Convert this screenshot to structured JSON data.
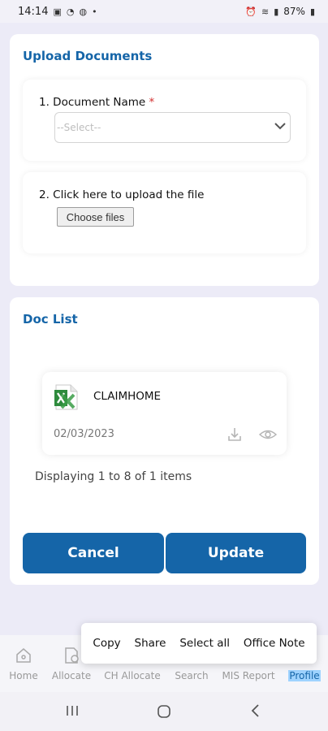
{
  "status_bar": {
    "time": "14:14",
    "battery": "87%"
  },
  "upload": {
    "title": "Upload Documents",
    "doc_name_label": "1.  Document Name",
    "required_mark": "*",
    "select_value": "--Select--",
    "upload_label": "2.  Click here to upload the file",
    "choose_files": "Choose files"
  },
  "doc_list": {
    "title": "Doc List",
    "items": [
      {
        "name": "CLAIMHOME",
        "date": "02/03/2023"
      }
    ],
    "displaying": "Displaying 1 to 8 of 1 items"
  },
  "actions": {
    "cancel": "Cancel",
    "update": "Update"
  },
  "context_menu": {
    "items": [
      "Copy",
      "Share",
      "Select all",
      "Office Note"
    ]
  },
  "bottom_nav": {
    "items": [
      {
        "label": "Home",
        "icon": "home-icon"
      },
      {
        "label": "Allocate",
        "icon": "allocate-icon"
      },
      {
        "label": "CH Allocate",
        "icon": "ch-allocate-icon"
      },
      {
        "label": "Search",
        "icon": "search-icon"
      },
      {
        "label": "MIS Report",
        "icon": "report-icon"
      },
      {
        "label": "Profile",
        "icon": "profile-icon",
        "active": true
      }
    ]
  },
  "colors": {
    "accent": "#1565a8",
    "background": "#ecebf7",
    "required": "#d32f2f"
  }
}
